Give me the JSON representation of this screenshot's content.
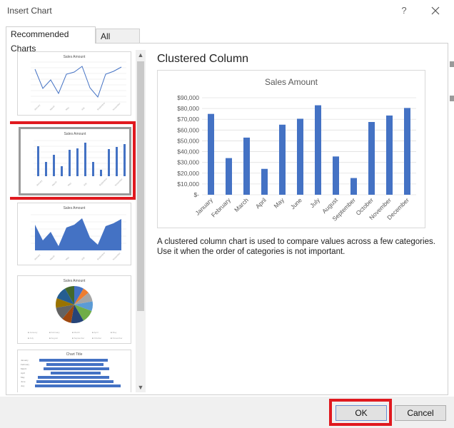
{
  "window": {
    "title": "Insert Chart",
    "help_glyph": "?"
  },
  "tabs": [
    {
      "label": "Recommended Charts",
      "active": true
    },
    {
      "label": "All Charts",
      "active": false
    }
  ],
  "thumbnails": [
    {
      "type": "line",
      "title": "Sales Amount"
    },
    {
      "type": "bar",
      "title": "Sales Amount",
      "selected": true
    },
    {
      "type": "area",
      "title": "Sales Amount"
    },
    {
      "type": "pie",
      "title": "Sales Amount"
    },
    {
      "type": "horizontal-bar",
      "title": "Chart Title"
    }
  ],
  "preview": {
    "heading": "Clustered Column",
    "description": "A clustered column chart is used to compare values across a few categories. Use it when the order of categories is not important."
  },
  "chart_data": {
    "type": "bar",
    "title": "Sales Amount",
    "categories": [
      "January",
      "February",
      "March",
      "April",
      "May",
      "June",
      "July",
      "August",
      "September",
      "October",
      "November",
      "December"
    ],
    "values": [
      75000,
      34000,
      53000,
      24000,
      65000,
      70500,
      83000,
      35500,
      15500,
      67500,
      73500,
      80500
    ],
    "yticks": [
      "$-",
      "$10,000",
      "$20,000",
      "$30,000",
      "$40,000",
      "$50,000",
      "$60,000",
      "$70,000",
      "$80,000",
      "$90,000"
    ],
    "ylim": [
      0,
      90000
    ],
    "grid": true,
    "color": "#4472c4"
  },
  "footer": {
    "ok_label": "OK",
    "cancel_label": "Cancel"
  },
  "colors": {
    "accent": "#4472c4",
    "highlight": "#e0191f"
  }
}
